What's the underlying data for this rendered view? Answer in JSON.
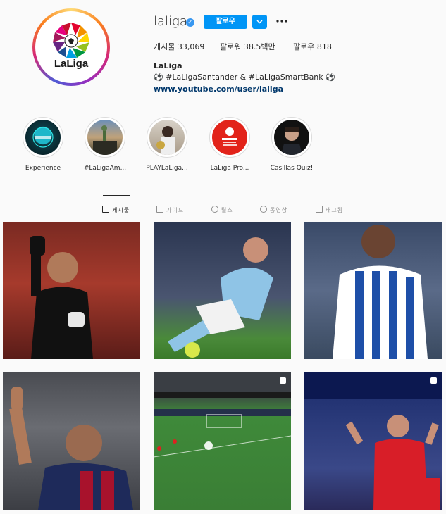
{
  "profile": {
    "username": "laliga",
    "avatar_text": "LaLiga",
    "follow_label": "팔로우",
    "stats": {
      "posts": "게시물 33,069",
      "followers": "팔로워 38.5백만",
      "following": "팔로우 818"
    },
    "bio_name": "LaLiga",
    "bio_line": "⚽ #LaLigaSantander & #LaLigaSmartBank ⚽",
    "bio_link": "www.youtube.com/user/laliga"
  },
  "stories": [
    {
      "label": "Experience"
    },
    {
      "label": "#LaLigaAm..."
    },
    {
      "label": "PLAYLaLiga..."
    },
    {
      "label": "LaLiga Pro..."
    },
    {
      "label": "Casillas Quiz!"
    }
  ],
  "tabs": [
    {
      "label": "게시물"
    },
    {
      "label": "가이드"
    },
    {
      "label": "릴스"
    },
    {
      "label": "동영상"
    },
    {
      "label": "태그됨"
    }
  ],
  "colors": {
    "accent": "#0095f6",
    "verified": "#3897f0",
    "link": "#00376b"
  }
}
